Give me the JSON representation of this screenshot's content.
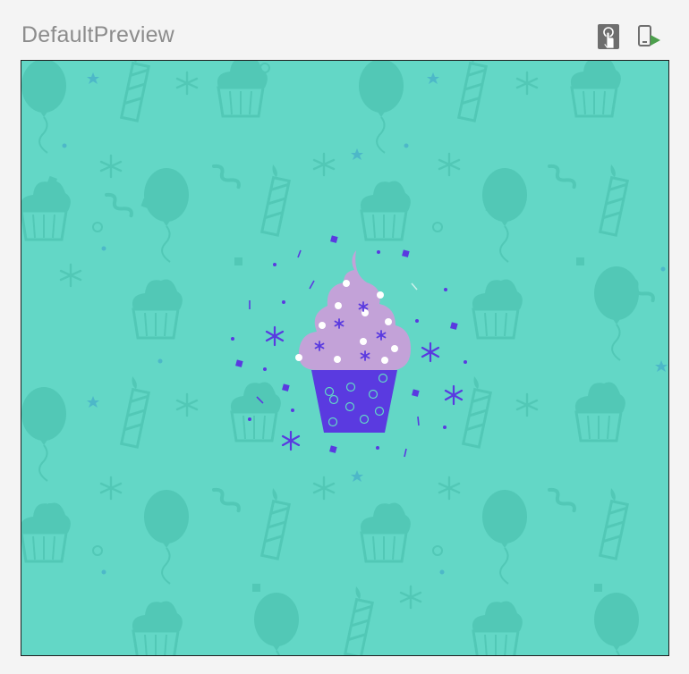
{
  "preview": {
    "title": "DefaultPreview"
  },
  "toolbar": {
    "interactive_icon": "touch-interactive-icon",
    "deploy_icon": "deploy-to-device-icon"
  },
  "canvas": {
    "background_color": "#63d7c6",
    "pattern_color": "#52c8b6",
    "cupcake_frosting_color": "#c3a2d8",
    "cupcake_base_color": "#5a3ae0",
    "confetti_color": "#5a3ae0"
  }
}
